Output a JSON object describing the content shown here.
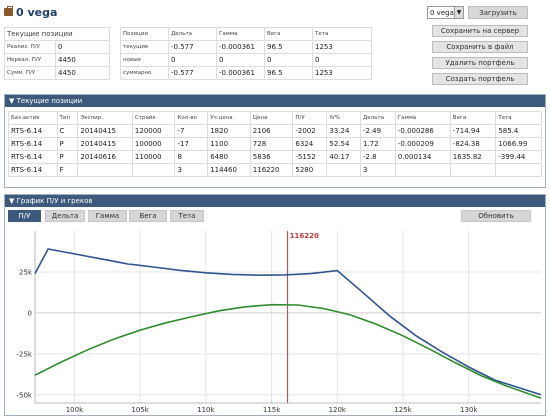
{
  "header": {
    "title": "0 vega",
    "selected_portfolio": "0 vega",
    "load_label": "Загрузить"
  },
  "actions": {
    "save_server": "Сохранить на сервер",
    "save_file": "Сохранить в файл",
    "delete": "Удалить портфель",
    "create": "Создать портфель"
  },
  "pnl": {
    "header": "Текущие позиции",
    "rows": [
      {
        "label": "Реализ. П/У",
        "value": "0"
      },
      {
        "label": "Нереал. П/У",
        "value": "4450"
      },
      {
        "label": "Сумм. П/У",
        "value": "4450"
      }
    ]
  },
  "pos_summary": {
    "headers": [
      "Позиции",
      "Дельта",
      "Гамма",
      "Вега",
      "Тета"
    ],
    "rows": [
      [
        "текущие",
        "-0.577",
        "-0.000361",
        "96.5",
        "1253"
      ],
      [
        "новые",
        "0",
        "0",
        "0",
        "0"
      ],
      [
        "суммарно",
        "-0.577",
        "-0.000361",
        "96.5",
        "1253"
      ]
    ]
  },
  "current_positions": {
    "title": "▼ Текущие позиции",
    "headers": [
      "Баз.актив",
      "Тип",
      "Экспир.",
      "Страйк",
      "Кол-во",
      "Уч.цена",
      "Цена",
      "П/У",
      "IV%",
      "Дельта",
      "Гамма",
      "Вега",
      "Тета"
    ],
    "rows": [
      [
        "RTS-6.14",
        "C",
        "20140415",
        "120000",
        "-7",
        "1820",
        "2106",
        "-2002",
        "33.24",
        "-2.49",
        "-0.000286",
        "-714.94",
        "585.4"
      ],
      [
        "RTS-6.14",
        "P",
        "20140415",
        "100000",
        "-17",
        "1100",
        "728",
        "6324",
        "52.54",
        "1.72",
        "-0.000209",
        "-824.38",
        "1066.99"
      ],
      [
        "RTS-6.14",
        "P",
        "20140616",
        "110000",
        "8",
        "6480",
        "5836",
        "-5152",
        "40.17",
        "-2.8",
        "0.000134",
        "1635.82",
        "-399.44"
      ],
      [
        "RTS-6.14",
        "F",
        "",
        "",
        "3",
        "114460",
        "116220",
        "5280",
        "",
        "3",
        "",
        "",
        ""
      ]
    ]
  },
  "chart_panel": {
    "title": "▼ График П/У и греков",
    "tabs": [
      "П/У",
      "Дельта",
      "Гамма",
      "Вега",
      "Тета"
    ],
    "refresh_label": "Обновить"
  },
  "chart_data": {
    "type": "line",
    "current_price": 116220,
    "current_price_label": "116220",
    "xlim": [
      97000,
      135500
    ],
    "ylim": [
      -55000,
      50000
    ],
    "x_ticks": [
      100000,
      105000,
      110000,
      115000,
      120000,
      125000,
      130000
    ],
    "x_tick_labels": [
      "100k",
      "105k",
      "110k",
      "115k",
      "120k",
      "125k",
      "130k"
    ],
    "y_ticks": [
      25000,
      0,
      -25000,
      -50000
    ],
    "y_tick_labels": [
      "25k",
      "0",
      "-25k",
      "-50k"
    ],
    "grid": true,
    "colors": {
      "expiry": "#2f5590",
      "current": "#2e8b2e",
      "marker": "#c0393b"
    },
    "series": [
      {
        "x": [
          97000,
          98000,
          100000,
          102000,
          104000,
          106000,
          108000,
          110000,
          112000,
          114000,
          116000,
          118000,
          120000,
          122000,
          124000,
          126000,
          128000,
          130000,
          132000,
          135500
        ],
        "values": [
          24000,
          39000,
          36000,
          33000,
          30000,
          28000,
          26000,
          24500,
          23500,
          23000,
          23200,
          24000,
          25800,
          12000,
          -2000,
          -14000,
          -24000,
          -33000,
          -41000,
          -50000
        ]
      },
      {
        "x": [
          97000,
          99000,
          101000,
          103000,
          105000,
          107000,
          109000,
          111000,
          113000,
          115000,
          117000,
          119000,
          121000,
          123000,
          125000,
          127000,
          129000,
          131000,
          133000,
          135500
        ],
        "values": [
          -38000,
          -30000,
          -22500,
          -16000,
          -10500,
          -6000,
          -2200,
          1300,
          3700,
          5000,
          4800,
          2600,
          -1200,
          -7000,
          -14000,
          -22000,
          -30500,
          -38500,
          -45000,
          -52000
        ]
      }
    ]
  }
}
